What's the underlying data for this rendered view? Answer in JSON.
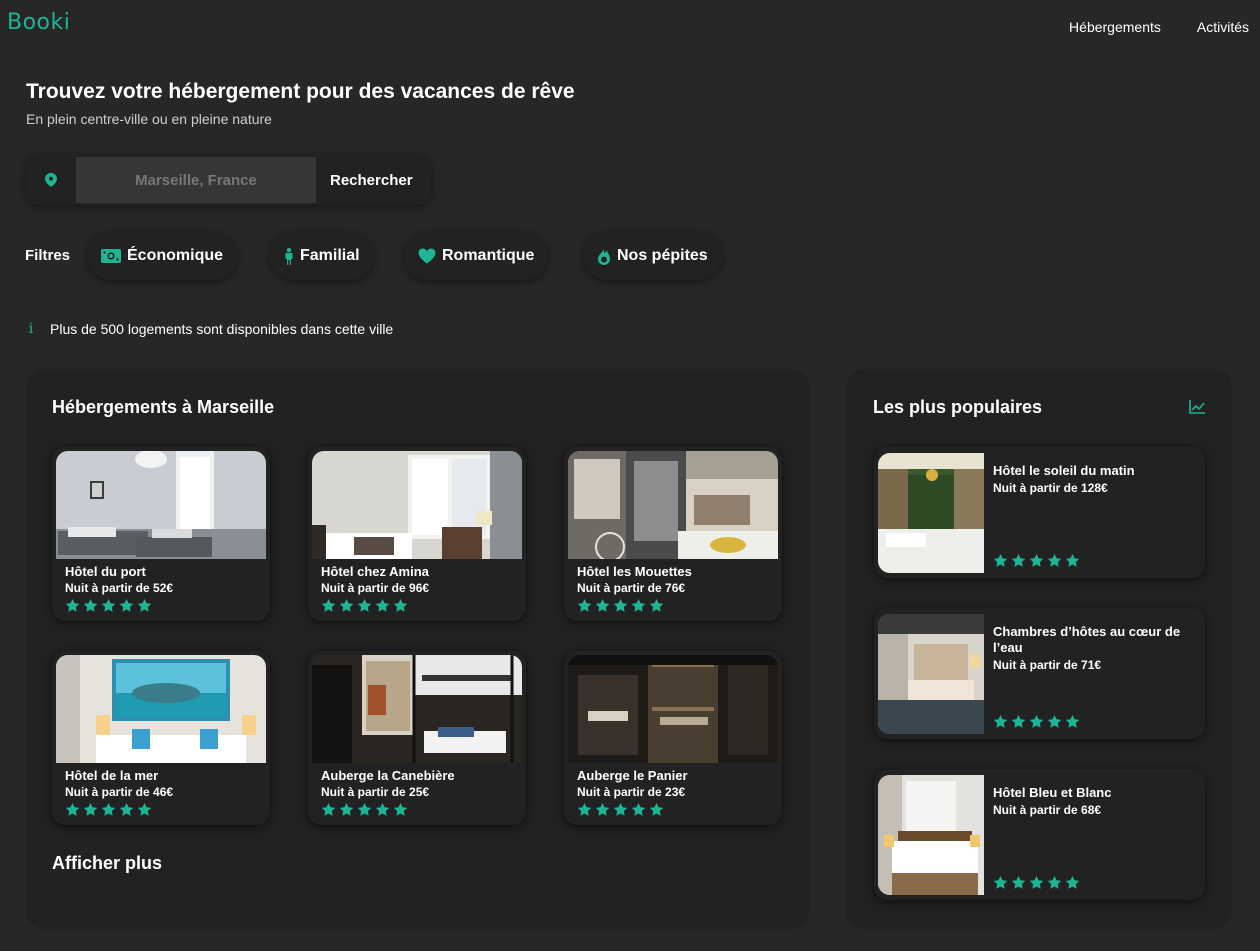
{
  "brand": {
    "logo": "Booki",
    "accent": "#1db595"
  },
  "nav": {
    "accommodations": "Hébergements",
    "activities": "Activités"
  },
  "hero": {
    "title": "Trouvez votre hébergement pour des vacances de rêve",
    "subtitle": "En plein centre-ville ou en pleine nature"
  },
  "search": {
    "placeholder": "Marseille, France",
    "button": "Rechercher",
    "icon": "location-pin-icon"
  },
  "filters": {
    "label": "Filtres",
    "items": [
      {
        "label": "Économique",
        "icon": "money-icon"
      },
      {
        "label": "Familial",
        "icon": "person-icon"
      },
      {
        "label": "Romantique",
        "icon": "heart-icon"
      },
      {
        "label": "Nos pépites",
        "icon": "fire-icon"
      }
    ]
  },
  "info": {
    "icon": "info-icon",
    "text": "Plus de 500 logements sont disponibles dans cette ville"
  },
  "main": {
    "title": "Hébergements à Marseille",
    "more": "Afficher plus",
    "cards": [
      {
        "name": "Hôtel du port",
        "price": "Nuit à partir de 52€",
        "rating": 5
      },
      {
        "name": "Hôtel chez Amina",
        "price": "Nuit à partir de 96€",
        "rating": 5
      },
      {
        "name": "Hôtel les Mouettes",
        "price": "Nuit à partir de 76€",
        "rating": 5
      },
      {
        "name": "Hôtel de la mer",
        "price": "Nuit à partir de 46€",
        "rating": 5
      },
      {
        "name": "Auberge la Canebière",
        "price": "Nuit à partir de 25€",
        "rating": 5
      },
      {
        "name": "Auberge le Panier",
        "price": "Nuit à partir de 23€",
        "rating": 5
      }
    ]
  },
  "popular": {
    "title": "Les plus populaires",
    "icon": "trend-chart-icon",
    "cards": [
      {
        "name": "Hôtel le soleil du matin",
        "price": "Nuit à partir de 128€",
        "rating": 5
      },
      {
        "name": "Chambres d’hôtes au cœur de l’eau",
        "price": "Nuit à partir de 71€",
        "rating": 5
      },
      {
        "name": "Hôtel Bleu et Blanc",
        "price": "Nuit à partir de 68€",
        "rating": 5
      }
    ]
  }
}
